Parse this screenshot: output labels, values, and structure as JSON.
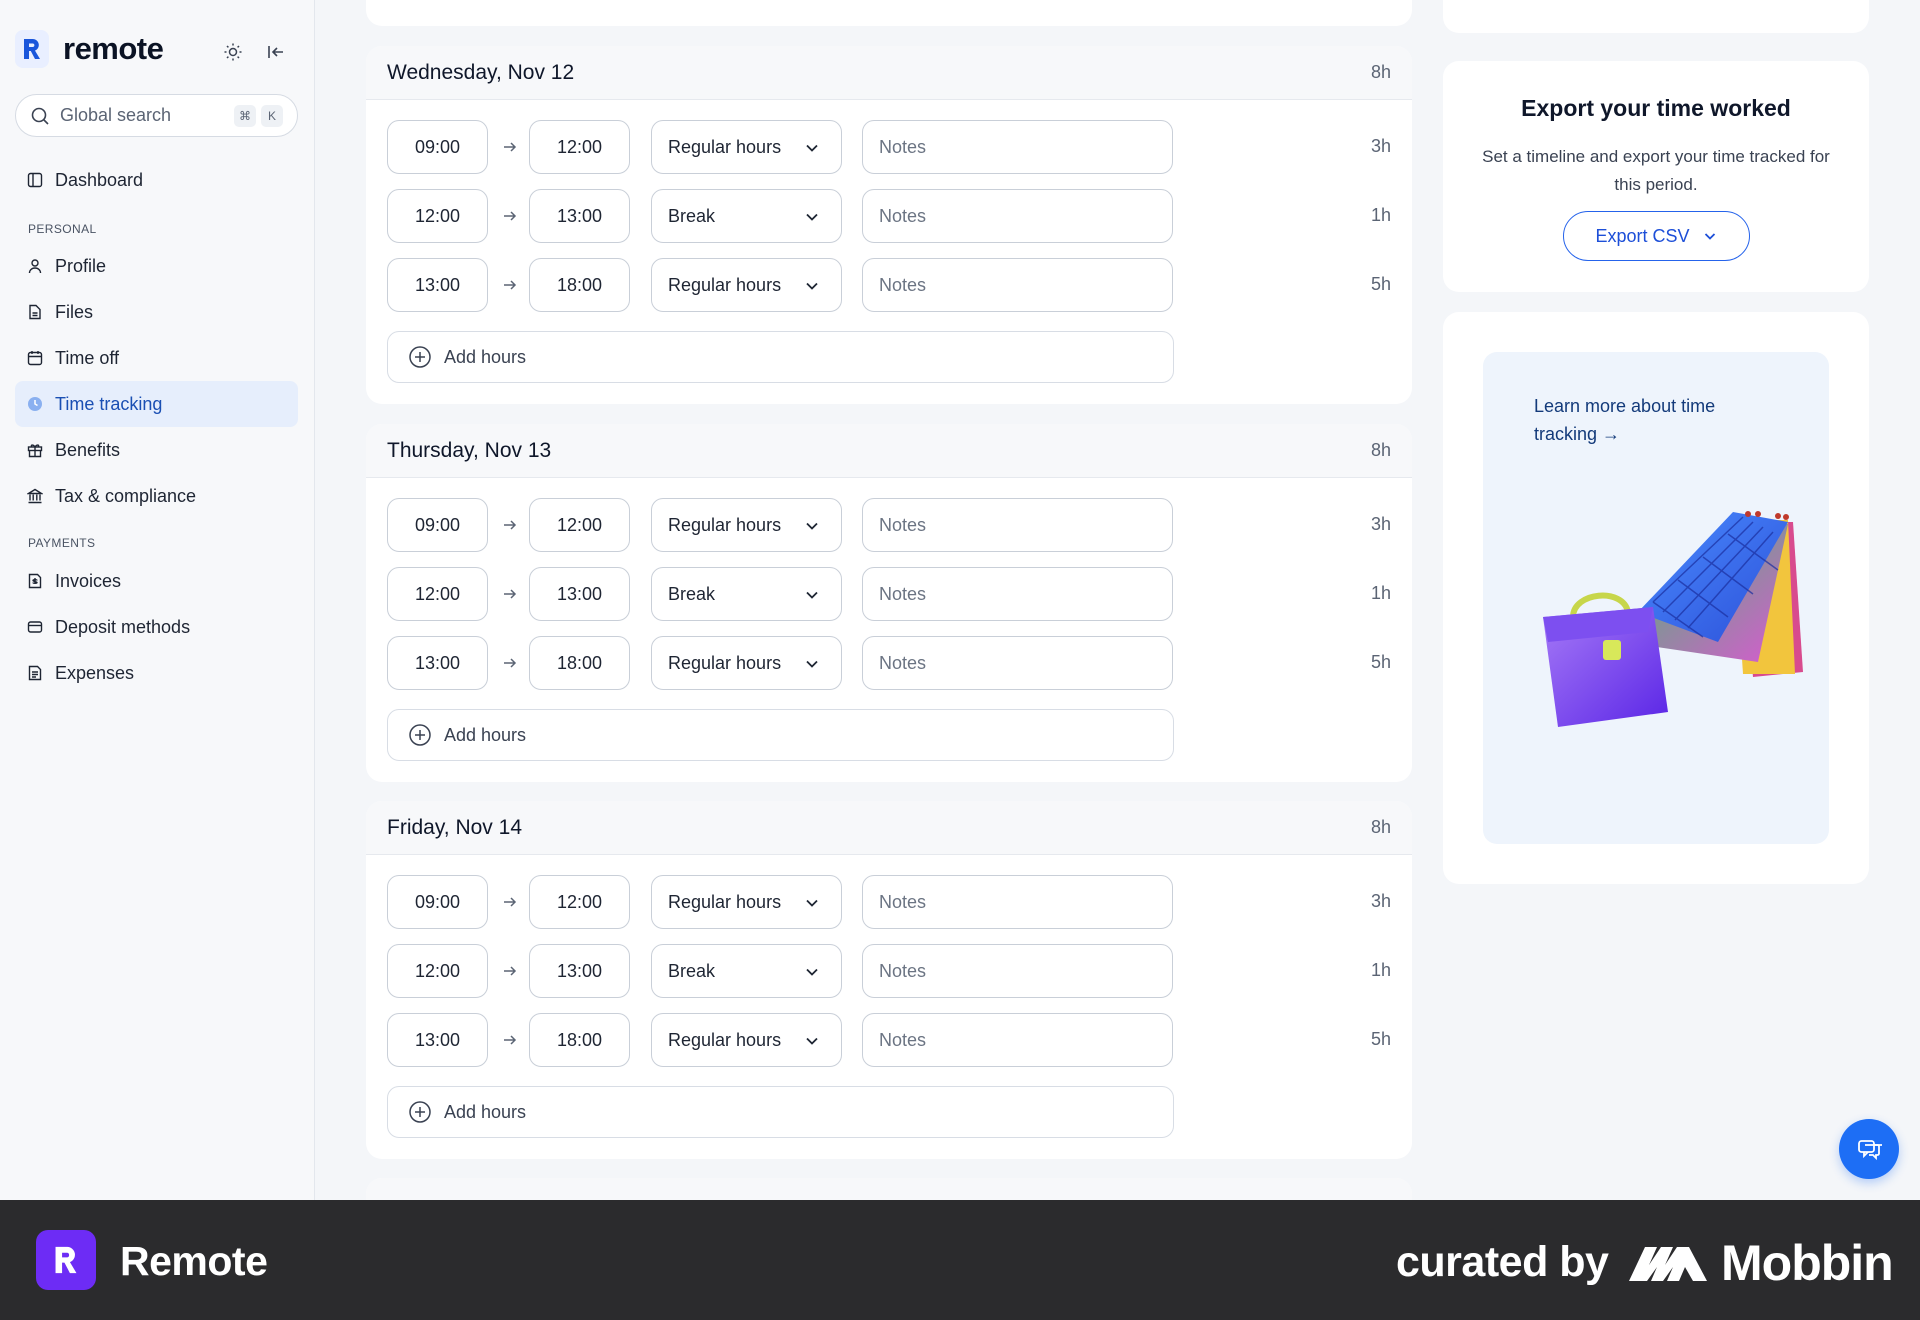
{
  "brand": {
    "name": "remote",
    "accent": "#1a56db"
  },
  "search": {
    "placeholder": "Global search",
    "kbd1": "⌘",
    "kbd2": "K"
  },
  "nav": {
    "dashboard": "Dashboard",
    "section_personal": "PERSONAL",
    "profile": "Profile",
    "files": "Files",
    "time_off": "Time off",
    "time_tracking": "Time tracking",
    "benefits": "Benefits",
    "tax": "Tax & compliance",
    "section_payments": "PAYMENTS",
    "invoices": "Invoices",
    "deposit": "Deposit methods",
    "expenses": "Expenses"
  },
  "days": [
    {
      "title": "Wednesday, Nov 12",
      "total": "8h",
      "rows": [
        {
          "start": "09:00",
          "end": "12:00",
          "type": "Regular hours",
          "notes": "Notes",
          "hours": "3h"
        },
        {
          "start": "12:00",
          "end": "13:00",
          "type": "Break",
          "notes": "Notes",
          "hours": "1h"
        },
        {
          "start": "13:00",
          "end": "18:00",
          "type": "Regular hours",
          "notes": "Notes",
          "hours": "5h"
        }
      ],
      "add_label": "Add hours"
    },
    {
      "title": "Thursday, Nov 13",
      "total": "8h",
      "rows": [
        {
          "start": "09:00",
          "end": "12:00",
          "type": "Regular hours",
          "notes": "Notes",
          "hours": "3h"
        },
        {
          "start": "12:00",
          "end": "13:00",
          "type": "Break",
          "notes": "Notes",
          "hours": "1h"
        },
        {
          "start": "13:00",
          "end": "18:00",
          "type": "Regular hours",
          "notes": "Notes",
          "hours": "5h"
        }
      ],
      "add_label": "Add hours"
    },
    {
      "title": "Friday, Nov 14",
      "total": "8h",
      "rows": [
        {
          "start": "09:00",
          "end": "12:00",
          "type": "Regular hours",
          "notes": "Notes",
          "hours": "3h"
        },
        {
          "start": "12:00",
          "end": "13:00",
          "type": "Break",
          "notes": "Notes",
          "hours": "1h"
        },
        {
          "start": "13:00",
          "end": "18:00",
          "type": "Regular hours",
          "notes": "Notes",
          "hours": "5h"
        }
      ],
      "add_label": "Add hours"
    }
  ],
  "export": {
    "title": "Export your time worked",
    "description": "Set a timeline and export your time tracked for this period.",
    "button": "Export CSV"
  },
  "promo": {
    "link": "Learn more about time tracking →"
  },
  "footer": {
    "app": "Remote",
    "curated": "curated by",
    "mobbin": "Mobbin"
  }
}
